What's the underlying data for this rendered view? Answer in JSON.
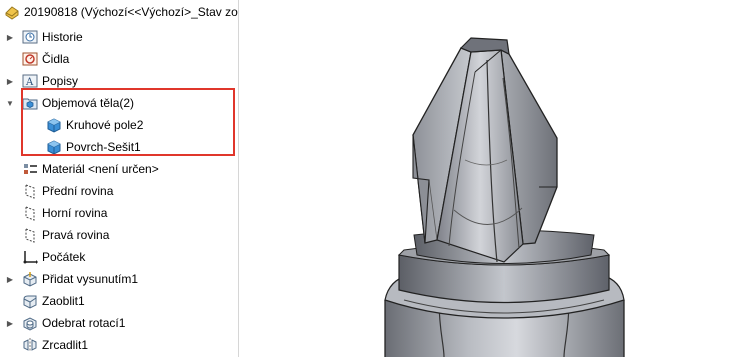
{
  "tree": {
    "root_label": "20190818  (Výchozí<<Výchozí>_Stav zob",
    "items": [
      {
        "label": "Historie",
        "icon": "history-icon"
      },
      {
        "label": "Čidla",
        "icon": "sensors-icon"
      },
      {
        "label": "Popisy",
        "icon": "annotations-icon"
      },
      {
        "label": "Objemová těla(2)",
        "icon": "solid-bodies-folder-icon"
      },
      {
        "label": "Kruhové pole2",
        "icon": "solid-body-icon"
      },
      {
        "label": "Povrch-Sešit1",
        "icon": "solid-body-icon"
      },
      {
        "label": "Materiál <není určen>",
        "icon": "material-icon"
      },
      {
        "label": "Přední rovina",
        "icon": "plane-icon"
      },
      {
        "label": "Horní rovina",
        "icon": "plane-icon"
      },
      {
        "label": "Pravá rovina",
        "icon": "plane-icon"
      },
      {
        "label": "Počátek",
        "icon": "origin-icon"
      },
      {
        "label": "Přidat vysunutím1",
        "icon": "extrude-icon"
      },
      {
        "label": "Zaoblit1",
        "icon": "fillet-icon"
      },
      {
        "label": "Odebrat rotací1",
        "icon": "revolve-cut-icon"
      },
      {
        "label": "Zrcadlit1",
        "icon": "mirror-icon"
      }
    ]
  },
  "colors": {
    "highlight": "#e0362b",
    "body_blue": "#3b8fd6",
    "folder_yellow": "#e8c25a"
  }
}
